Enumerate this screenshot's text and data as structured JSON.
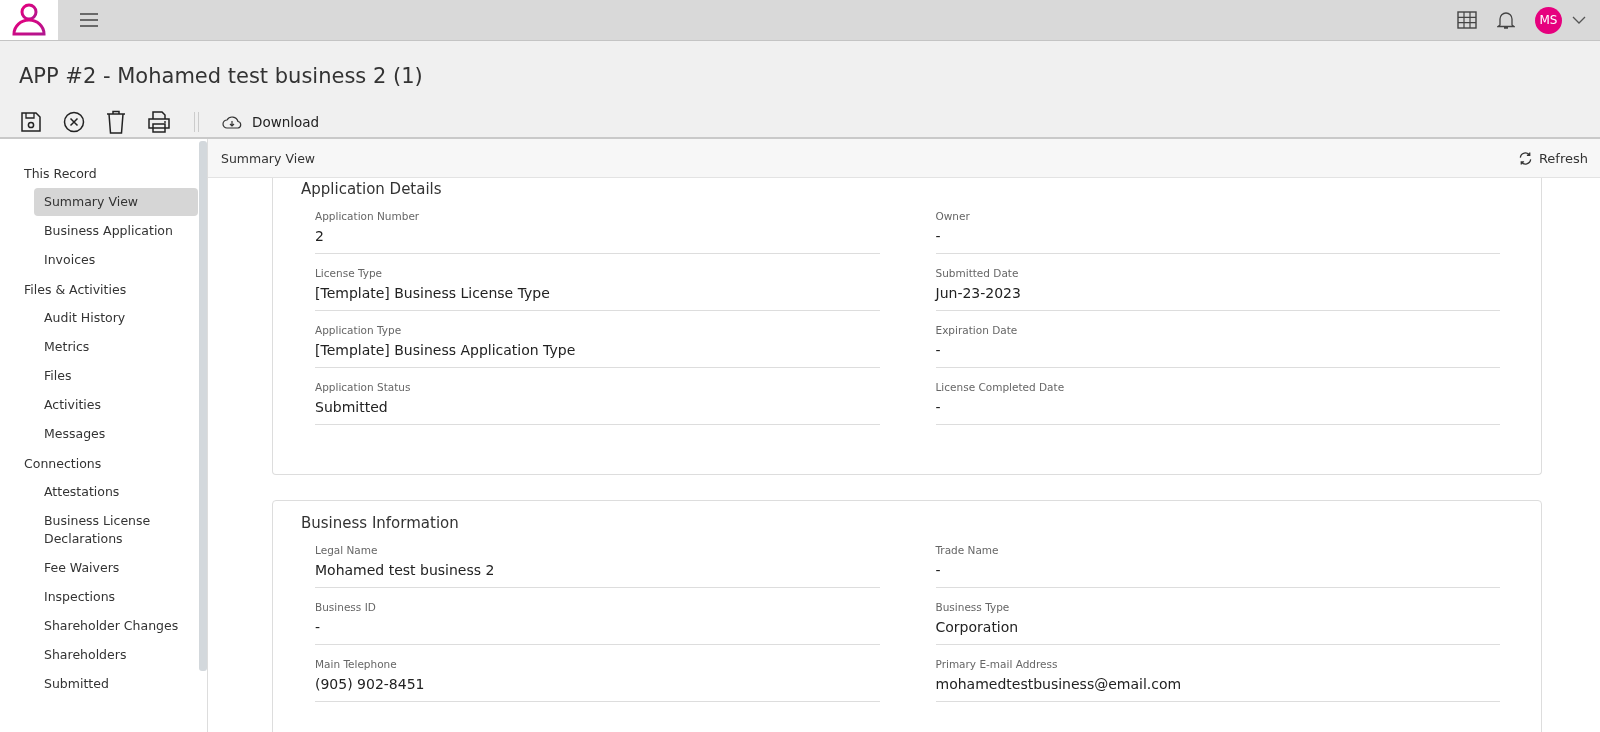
{
  "topbar": {
    "avatar": "MS"
  },
  "page": {
    "title": "APP #2 - Mohamed test business 2 (1)"
  },
  "toolbar": {
    "download": "Download"
  },
  "sidebar": {
    "groups": [
      {
        "label": "This Record",
        "items": [
          {
            "label": "Summary View",
            "selected": true
          },
          {
            "label": "Business Application",
            "selected": false
          },
          {
            "label": "Invoices",
            "selected": false
          }
        ]
      },
      {
        "label": "Files & Activities",
        "items": [
          {
            "label": "Audit History",
            "selected": false
          },
          {
            "label": "Metrics",
            "selected": false
          },
          {
            "label": "Files",
            "selected": false
          },
          {
            "label": "Activities",
            "selected": false
          },
          {
            "label": "Messages",
            "selected": false
          }
        ]
      },
      {
        "label": "Connections",
        "items": [
          {
            "label": "Attestations",
            "selected": false
          },
          {
            "label": "Business License Declarations",
            "selected": false
          },
          {
            "label": "Fee Waivers",
            "selected": false
          },
          {
            "label": "Inspections",
            "selected": false
          },
          {
            "label": "Shareholder Changes",
            "selected": false
          },
          {
            "label": "Shareholders",
            "selected": false
          },
          {
            "label": "Submitted",
            "selected": false
          }
        ]
      }
    ]
  },
  "content_header": {
    "title": "Summary View",
    "refresh": "Refresh"
  },
  "sections": [
    {
      "title": "Application Details",
      "fields": [
        {
          "label": "Application Number",
          "value": "2"
        },
        {
          "label": "Owner",
          "value": "-"
        },
        {
          "label": "License Type",
          "value": "[Template] Business License Type"
        },
        {
          "label": "Submitted Date",
          "value": "Jun-23-2023"
        },
        {
          "label": "Application Type",
          "value": "[Template] Business Application Type"
        },
        {
          "label": "Expiration Date",
          "value": "-"
        },
        {
          "label": "Application Status",
          "value": "Submitted"
        },
        {
          "label": "License Completed Date",
          "value": "-"
        }
      ]
    },
    {
      "title": "Business Information",
      "fields": [
        {
          "label": "Legal Name",
          "value": "Mohamed test business 2"
        },
        {
          "label": "Trade Name",
          "value": "-"
        },
        {
          "label": "Business ID",
          "value": "-"
        },
        {
          "label": "Business Type",
          "value": "Corporation"
        },
        {
          "label": "Main Telephone",
          "value": "(905) 902-8451"
        },
        {
          "label": "Primary E-mail Address",
          "value": "mohamedtestbusiness@email.com"
        }
      ]
    }
  ]
}
